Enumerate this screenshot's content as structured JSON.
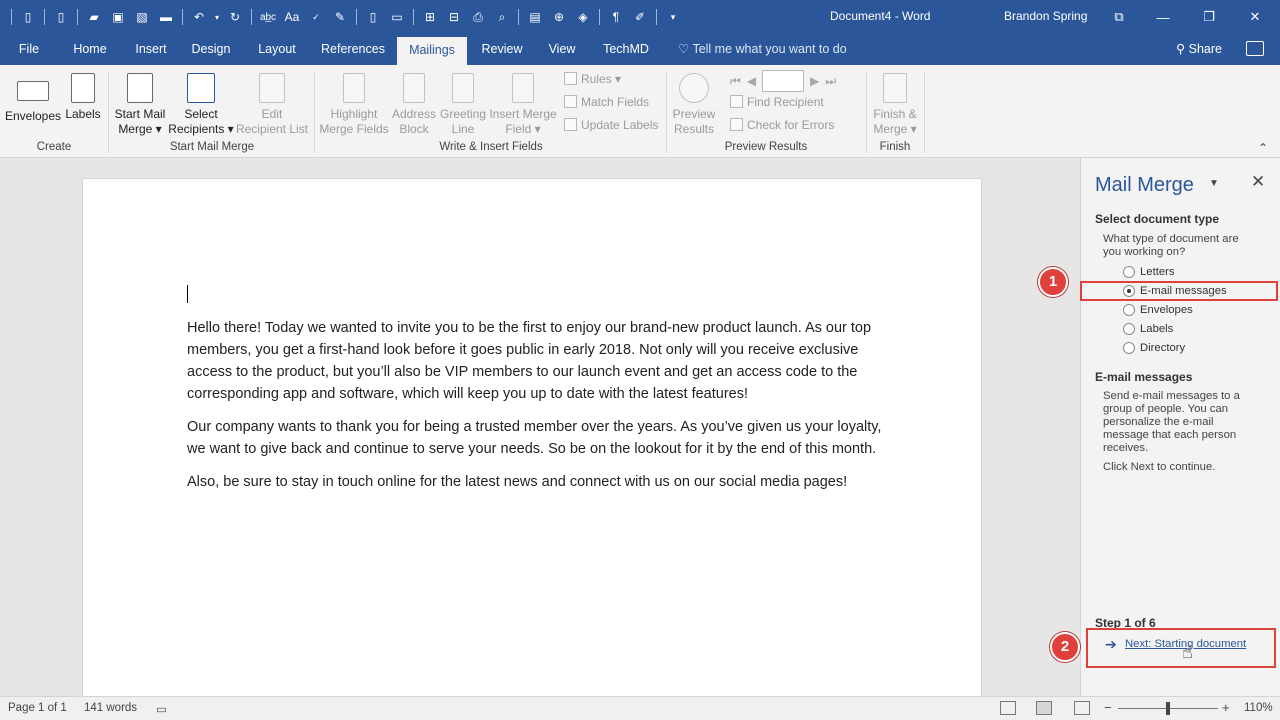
{
  "titlebar": {
    "document_title": "Document4  -  Word",
    "user": "Brandon Spring",
    "qat_icons": [
      "new-icon",
      "new-blank-icon",
      "open-icon",
      "save-icon",
      "save-as-icon",
      "folder-icon",
      "undo-icon",
      "redo-icon",
      "spelling-icon",
      "font-size-icon",
      "abc-check-icon",
      "track-icon",
      "page-icon",
      "document-icon",
      "compare-icon",
      "combine-icon",
      "print-icon",
      "preview-icon",
      "macro-icon",
      "paragraph-mark-icon",
      "format-painter-icon",
      "customize-icon"
    ],
    "glyph_abc": "ab̲c",
    "glyph_aa": "Aa",
    "glyph_pilcrow": "¶"
  },
  "tabs": [
    {
      "label": "File"
    },
    {
      "label": "Home"
    },
    {
      "label": "Insert"
    },
    {
      "label": "Design"
    },
    {
      "label": "Layout"
    },
    {
      "label": "References"
    },
    {
      "label": "Mailings"
    },
    {
      "label": "Review"
    },
    {
      "label": "View"
    },
    {
      "label": "TechMD"
    }
  ],
  "tellme": "Tell me what you want to do",
  "share": "Share",
  "ribbon": {
    "envelopes": "Envelopes",
    "labels": "Labels",
    "create_group": "Create",
    "start_mail_merge_1": "Start Mail",
    "start_mail_merge_2": "Merge ▾",
    "select_recipients_1": "Select",
    "select_recipients_2": "Recipients ▾",
    "edit_recipient_1": "Edit",
    "edit_recipient_2": "Recipient List",
    "start_group": "Start Mail Merge",
    "highlight_1": "Highlight",
    "highlight_2": "Merge Fields",
    "address_1": "Address",
    "address_2": "Block",
    "greeting_1": "Greeting",
    "greeting_2": "Line",
    "insert_merge_1": "Insert Merge",
    "insert_merge_2": "Field ▾",
    "rules": "Rules ▾",
    "match_fields": "Match Fields",
    "update_labels": "Update Labels",
    "write_group": "Write & Insert Fields",
    "preview_1": "Preview",
    "preview_2": "Results",
    "find_recipient": "Find Recipient",
    "check_errors": "Check for Errors",
    "preview_group": "Preview Results",
    "finish_1": "Finish &",
    "finish_2": "Merge ▾",
    "finish_group": "Finish"
  },
  "document": {
    "paragraphs": [
      "Hello there! Today we wanted to invite you to be the first to enjoy our brand-new product launch. As our top members, you get a first-hand look before it goes public in early 2018. Not only will you receive exclusive access to the product, but you’ll also be VIP members to our launch event and get an access code to the corresponding app and software, which will keep you up to date with the latest features!",
      "Our company wants to thank you for being a trusted member over the years. As you’ve given us your loyalty, we want to give back and continue to serve your needs. So be on the lookout for it by the end of this month.",
      "Also, be sure to stay in touch online for the latest news and connect with us on our social media pages!"
    ]
  },
  "pane": {
    "title": "Mail Merge",
    "select_heading": "Select document type",
    "question": "What type of document are you working on?",
    "options": [
      "Letters",
      "E-mail messages",
      "Envelopes",
      "Labels",
      "Directory"
    ],
    "selected": "E-mail messages",
    "section_heading": "E-mail messages",
    "description": "Send e-mail messages to a group of people. You can personalize the e-mail message that each person receives.",
    "instruction": "Click Next to continue.",
    "step": "Step 1 of 6",
    "next_link": "Next: Starting document"
  },
  "annotations": {
    "badge_1": "1",
    "badge_2": "2",
    "accent": "#e0403c"
  },
  "status": {
    "page": "Page 1 of 1",
    "words": "141 words",
    "zoom": "110%",
    "zoom_minus": "−",
    "zoom_plus": "+"
  },
  "colors": {
    "brand": "#2b579a",
    "ribbon_bg": "#f3f3f3"
  }
}
